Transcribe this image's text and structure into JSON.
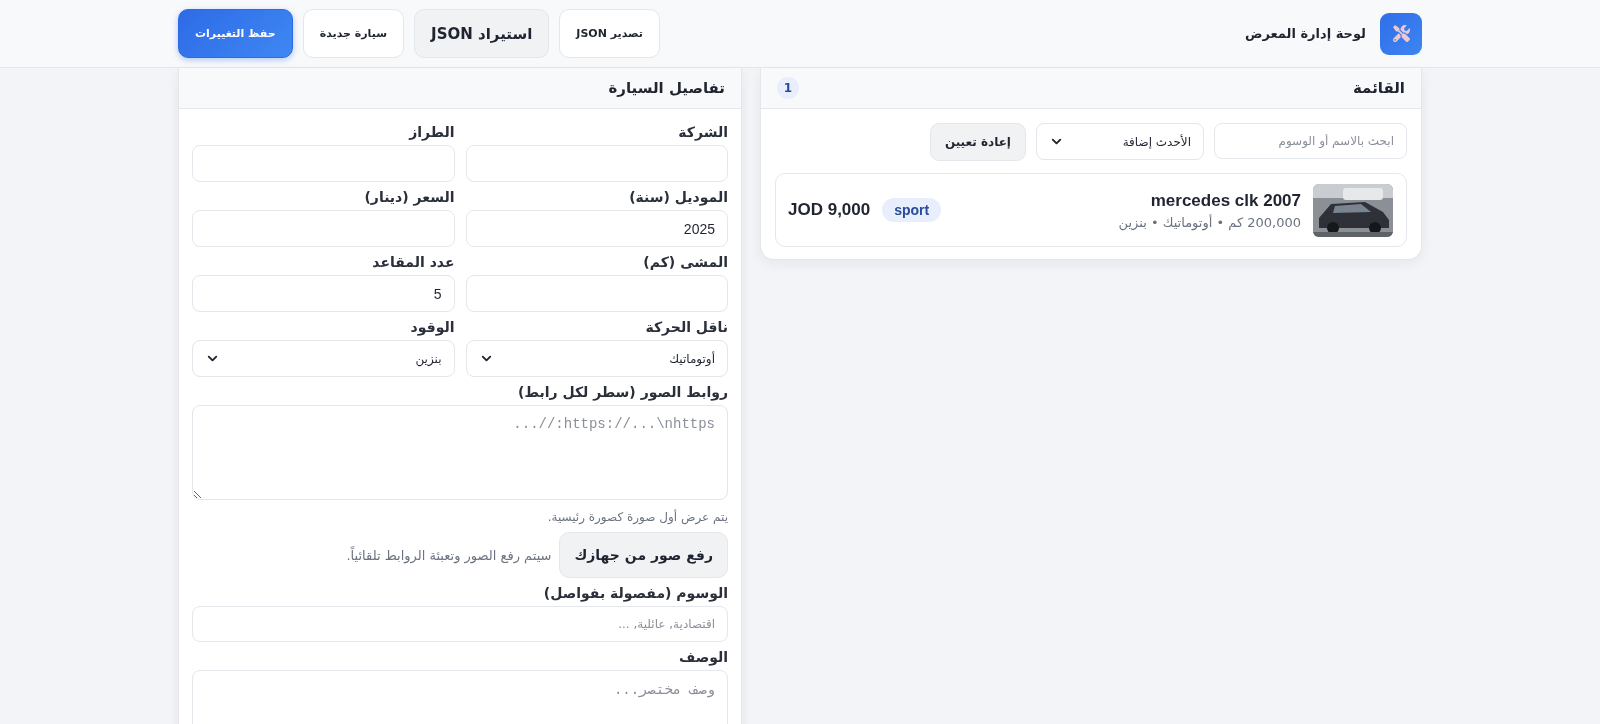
{
  "header": {
    "title": "لوحة إدارة المعرض",
    "buttons": [
      {
        "label": "تصدير JSON",
        "kind": "default"
      },
      {
        "label": "استيراد JSON",
        "kind": "muted"
      },
      {
        "label": "سيارة جديدة",
        "kind": "default"
      },
      {
        "label": "حفظ التغييرات",
        "kind": "primary"
      }
    ]
  },
  "list": {
    "title": "القائمة",
    "count": "1",
    "search": {
      "placeholder": "ابحث بالاسم أو الوسوم"
    },
    "sort": {
      "value": "الأحدث إضافة"
    },
    "reset": "إعادة تعيين",
    "cars": [
      {
        "kind": "picture",
        "title": "mercedes clk 2007",
        "meta": "200,000 كم • أوتوماتيك • بنزين",
        "tag": "sport",
        "price": "JOD 9,000"
      }
    ]
  },
  "form": {
    "title": "تفاصيل السيارة",
    "fields": [
      {
        "label": "الشركة",
        "kind": "input"
      },
      {
        "label": "الطراز",
        "kind": "input"
      },
      {
        "label": "الموديل (سنة)",
        "kind": "input",
        "value": "2025"
      },
      {
        "label": "السعر (دينار)",
        "kind": "input"
      },
      {
        "label": "المشى (كم)",
        "kind": "input"
      },
      {
        "label": "عدد المقاعد",
        "kind": "input",
        "value": "5"
      },
      {
        "label": "ناقل الحركة",
        "kind": "select",
        "value": "أوتوماتيك"
      },
      {
        "label": "الوقود",
        "kind": "select",
        "value": "بنزين"
      }
    ],
    "images": {
      "label": "روابط الصور (سطر لكل رابط)",
      "placeholder": "https://...\\nhttps://..."
    },
    "hint": "يتم عرض أول صورة كصورة رئيسية.",
    "upload": {
      "button": "رفع صور من جهازك",
      "note": "سيتم رفع الصور وتعبئة الروابط تلقائياً."
    },
    "tags": {
      "label": "الوسوم (مفصولة بفواصل)",
      "placeholder": "اقتصادية, عائلية, ..."
    },
    "description": {
      "label": "الوصف",
      "placeholder": "وصف مختصر..."
    }
  }
}
